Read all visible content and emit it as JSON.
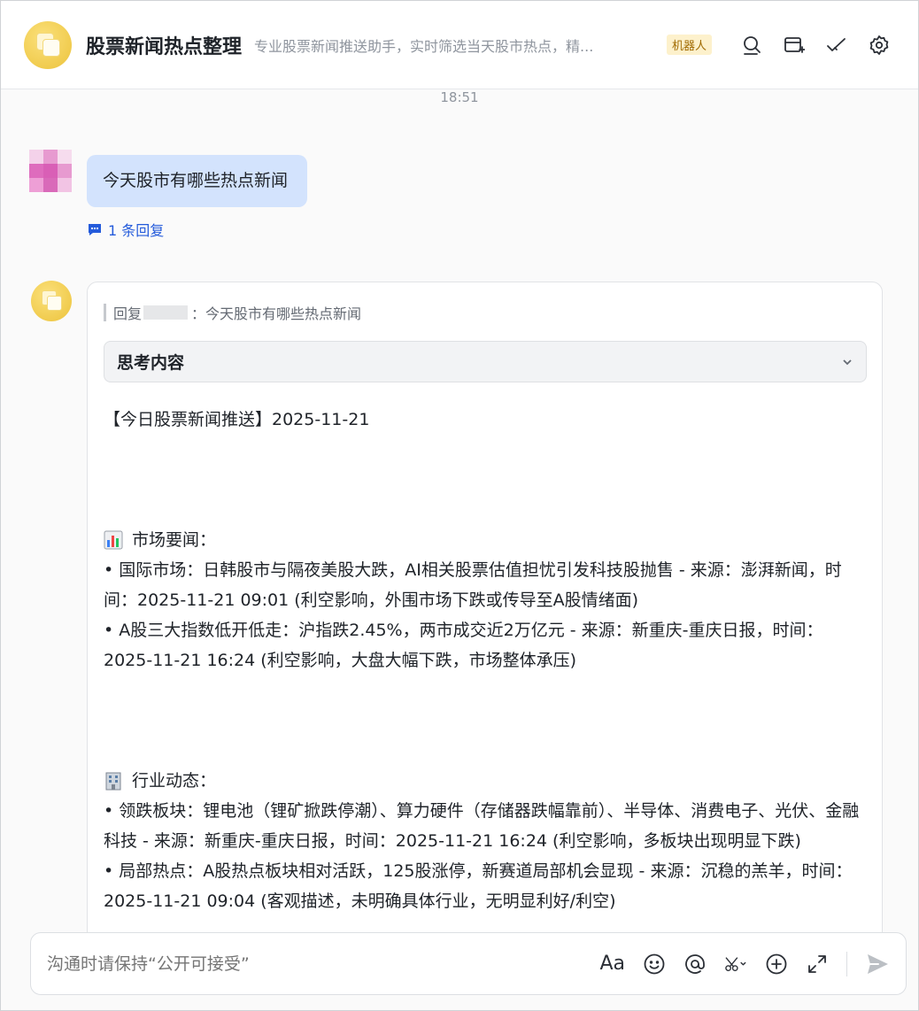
{
  "header": {
    "title": "股票新闻热点整理",
    "subtitle": "专业股票新闻推送助手，实时筛选当天股市热点，精...",
    "badge": "机器人",
    "icons": [
      "search-icon",
      "add-window-icon",
      "check-mark-icon",
      "settings-icon"
    ]
  },
  "timestamp": "18:51",
  "user_message": {
    "text": "今天股市有哪些热点新闻",
    "reply_count": "1 条回复"
  },
  "bot_message": {
    "quote_prefix": "回复",
    "quote_suffix": "：今天股市有哪些热点新闻",
    "thinking_label": "思考内容",
    "heading": "【今日股票新闻推送】2025-11-21",
    "sections": [
      {
        "icon": "bar-chart-icon",
        "title": "市场要闻：",
        "items": [
          "• 国际市场：日韩股市与隔夜美股大跌，AI相关股票估值担忧引发科技股抛售 - 来源：澎湃新闻，时间：2025-11-21 09:01 (利空影响，外围市场下跌或传导至A股情绪面)",
          "• A股三大指数低开低走：沪指跌2.45%，两市成交近2万亿元 - 来源：新重庆-重庆日报，时间：2025-11-21 16:24 (利空影响，大盘大幅下跌，市场整体承压)"
        ]
      },
      {
        "icon": "office-building-icon",
        "title": "行业动态：",
        "items": [
          "• 领跌板块：锂电池（锂矿掀跌停潮）、算力硬件（存储器跌幅靠前）、半导体、消费电子、光伏、金融科技 - 来源：新重庆-重庆日报，时间：2025-11-21 16:24 (利空影响，多板块出现明显下跌)",
          "• 局部热点：A股热点板块相对活跃，125股涨停，新赛道局部机会显现 - 来源：沉稳的羔羊，时间：2025-11-21 09:04 (客观描述，未明确具体行业，无明显利好/利空)"
        ]
      }
    ]
  },
  "composer": {
    "placeholder": "沟通时请保持“公开可接受”",
    "font_tool_label": "Aa"
  },
  "colors": {
    "accent": "#245bdb",
    "user_bubble": "#d3e3fd",
    "avatar_yellow": "#ecc33c"
  }
}
